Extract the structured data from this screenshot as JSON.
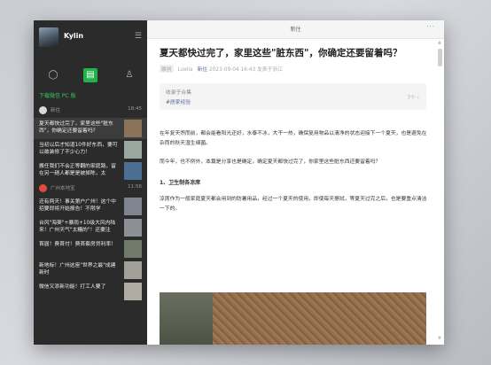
{
  "profile": {
    "name": "Kylin"
  },
  "sidebar": {
    "section_header": "下载微信 PC 版",
    "groups": [
      {
        "account": "新住",
        "time": "18:45",
        "items": [
          {
            "title": "夏天都快过完了，家里这些\"脏东西\"，你确定还要留着吗？",
            "selected": true,
            "thumb_color": "#8a7358"
          },
          {
            "title": "当初以后才知道10件好东西，要可以敢装修了不少心力！",
            "selected": false,
            "thumb_color": "#9aa6a0"
          },
          {
            "title": "搬任我们不会正等翻的家庭路，留在另一趟人都是是被掉陈，太",
            "selected": false,
            "thumb_color": "#4a6f93"
          }
        ]
      },
      {
        "account": "广州本地宝",
        "time": "11:56",
        "items": [
          {
            "title": "还有两天！事关第户广州！这个中招要即将开始报告！不限学",
            "selected": false,
            "thumb_color": "#7e8590"
          },
          {
            "title": "台风\"海葵\"+暴雨+10级大风内陆来！广州天气\"太糟的\"！还要注",
            "selected": false,
            "thumb_color": "#8c8f95"
          },
          {
            "title": "首届！费首付！费首套房贷利率！",
            "selected": false,
            "thumb_color": "#6f7a68"
          },
          {
            "title": "新地标！广州这座\"世界之最\"成建新时",
            "selected": false,
            "thumb_color": "#a39f99"
          },
          {
            "title": "微信又添新功能！打工人要了",
            "selected": false,
            "thumb_color": "#b0aba3"
          }
        ]
      }
    ]
  },
  "window": {
    "title": "新住",
    "more": "···"
  },
  "article": {
    "title": "夏天都快过完了，家里这些\"脏东西\"，你确定还要留着吗？",
    "original_badge": "原创",
    "author": "Luella",
    "account": "新住",
    "date": "2023-09-04 16:43",
    "location": "发表于浙江",
    "card_line1": "收录于合集",
    "card_line2": "#居家经验",
    "card_count": "7个 ›",
    "para1": "在年复天煦而前，都会能看阳光还好，水泰不冰，大干一热，确保复用物品以清净的状态迎接下一个夏天，也是避免在杂而的秋天湿生细菌。",
    "para2": "而今年，也不例外，本篇是分享也是确定，确定夏天都快过完了，你家里这些脏东西还要留着吗？",
    "subhead": "1、卫生制各凉席",
    "para3": "凉席作为一般家庭夏天都会用到的防暑用品，经过一个夏天的使用，即使每天擦拭，等夏天过完之后，也是要重点清洁一下的。"
  }
}
